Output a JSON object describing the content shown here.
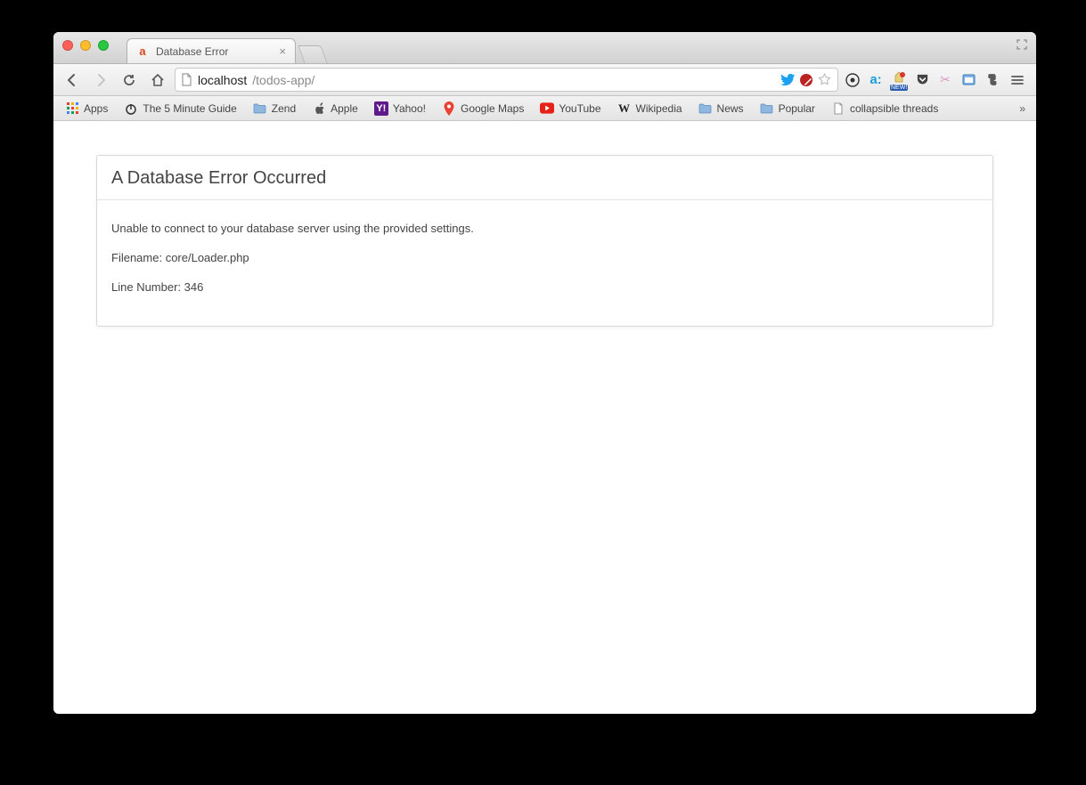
{
  "tab": {
    "title": "Database Error",
    "favicon_letter": "a"
  },
  "address": {
    "host": "localhost",
    "path": "/todos-app/"
  },
  "bookmarks": {
    "apps_label": "Apps",
    "items": [
      {
        "label": "The 5 Minute Guide",
        "kind": "power"
      },
      {
        "label": "Zend",
        "kind": "folder"
      },
      {
        "label": "Apple",
        "kind": "apple"
      },
      {
        "label": "Yahoo!",
        "kind": "yahoo"
      },
      {
        "label": "Google Maps",
        "kind": "gmaps"
      },
      {
        "label": "YouTube",
        "kind": "youtube"
      },
      {
        "label": "Wikipedia",
        "kind": "wiki"
      },
      {
        "label": "News",
        "kind": "folder"
      },
      {
        "label": "Popular",
        "kind": "folder"
      },
      {
        "label": "collapsible threads",
        "kind": "page"
      }
    ]
  },
  "page": {
    "error_heading": "A Database Error Occurred",
    "error_message": "Unable to connect to your database server using the provided settings.",
    "error_filename": "Filename: core/Loader.php",
    "error_line": "Line Number: 346"
  },
  "extensions": {
    "omnibox_icons": [
      "twitter",
      "block",
      "star"
    ],
    "toolbar_icons": [
      "eye",
      "a-colon",
      "new",
      "pocket",
      "scissors",
      "frame",
      "evernote"
    ]
  }
}
